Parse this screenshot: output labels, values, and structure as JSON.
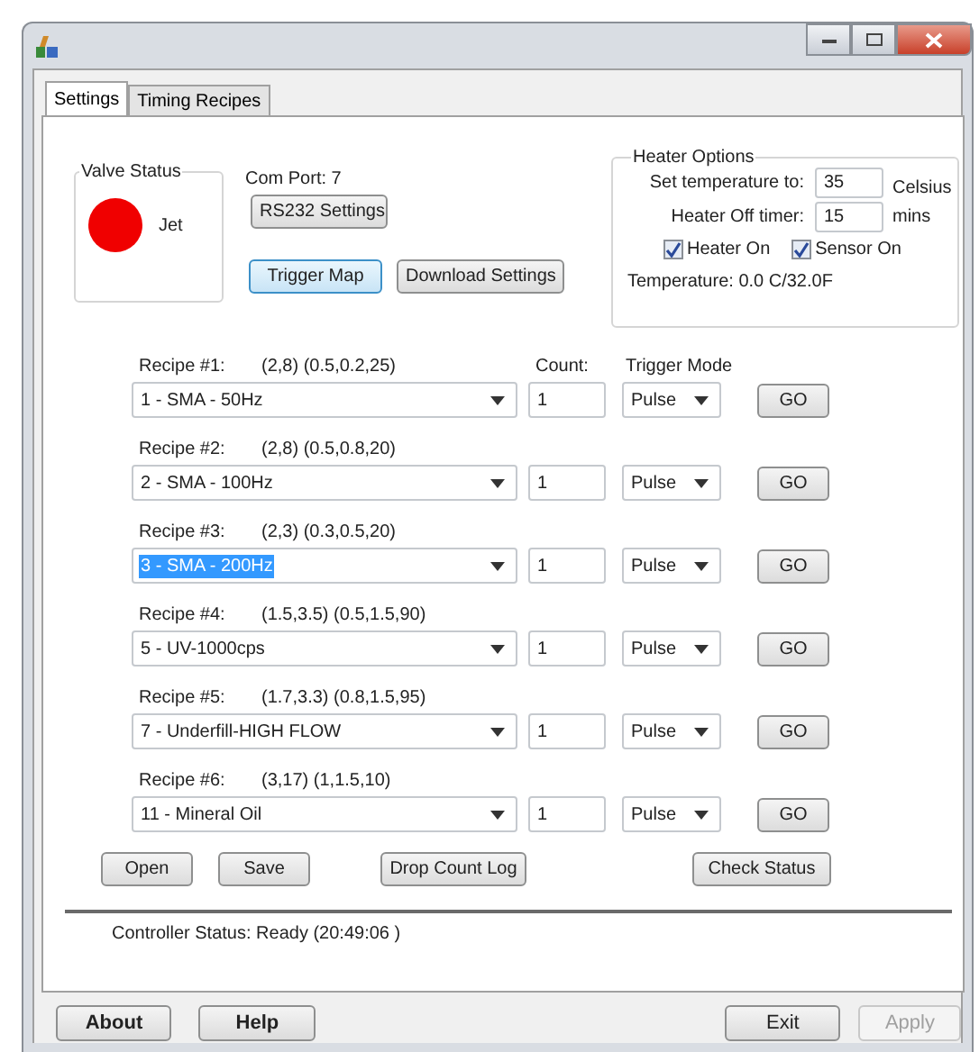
{
  "tabs": [
    {
      "label": "Settings",
      "selected": true
    },
    {
      "label": "Timing Recipes",
      "selected": false
    }
  ],
  "valve_status": {
    "title": "Valve Status",
    "on": true,
    "label": "Jet"
  },
  "com_port": {
    "label": "Com Port:",
    "value": "7"
  },
  "buttons_top": [
    "RS232 Settings",
    "Trigger Map",
    "Download Settings"
  ],
  "heater_options": {
    "title": "Heater Options",
    "set_temperature": {
      "label": "Set temperature to:",
      "value": "35",
      "unit": "Celsius"
    },
    "off_timer": {
      "label": "Heater Off timer:",
      "value": "15",
      "unit": "mins"
    },
    "checkboxes": [
      {
        "label": "Heater On",
        "checked": true
      },
      {
        "label": "Sensor On",
        "checked": true
      }
    ],
    "temperature": "Temperature: 0.0 C/32.0F"
  },
  "columns": {
    "count": "Count:",
    "trigger_mode": "Trigger Mode"
  },
  "recipes": [
    {
      "label": "Recipe #1:",
      "params": "(2,8)  (0.5,0.2,25)",
      "value": "1 - SMA - 50Hz",
      "selected": false,
      "count": "1",
      "mode": "Pulse",
      "go": "GO"
    },
    {
      "label": "Recipe #2:",
      "params": "(2,8)  (0.5,0.8,20)",
      "value": "2 - SMA - 100Hz",
      "selected": false,
      "count": "1",
      "mode": "Pulse",
      "go": "GO"
    },
    {
      "label": "Recipe #3:",
      "params": "(2,3)  (0.3,0.5,20)",
      "value": "3 - SMA - 200Hz",
      "selected": true,
      "count": "1",
      "mode": "Pulse",
      "go": "GO"
    },
    {
      "label": "Recipe #4:",
      "params": "(1.5,3.5)  (0.5,1.5,90)",
      "value": "5 - UV-1000cps",
      "selected": false,
      "count": "1",
      "mode": "Pulse",
      "go": "GO"
    },
    {
      "label": "Recipe #5:",
      "params": "(1.7,3.3)  (0.8,1.5,95)",
      "value": "7 - Underfill-HIGH FLOW",
      "selected": false,
      "count": "1",
      "mode": "Pulse",
      "go": "GO"
    },
    {
      "label": "Recipe #6:",
      "params": "(3,17)  (1,1.5,10)",
      "value": "11 - Mineral Oil",
      "selected": false,
      "count": "1",
      "mode": "Pulse",
      "go": "GO"
    }
  ],
  "buttons_bottom": [
    "Open",
    "Save",
    "Drop Count Log",
    "Check Status"
  ],
  "controller_status": "Controller Status:  Ready (20:49:06 )",
  "dialog_buttons": [
    {
      "label": "About",
      "disabled": false
    },
    {
      "label": "Help",
      "disabled": false
    },
    {
      "label": "Exit",
      "disabled": false
    },
    {
      "label": "Apply",
      "disabled": true
    }
  ]
}
